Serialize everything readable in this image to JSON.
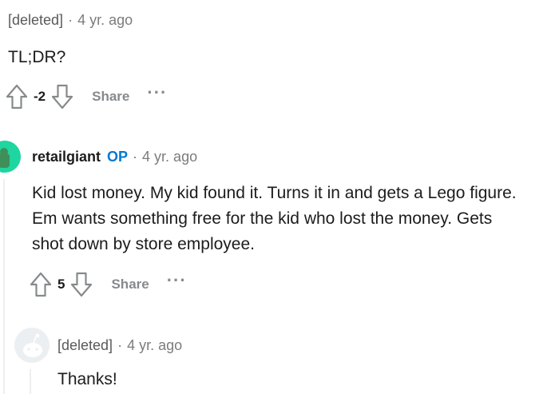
{
  "comment1": {
    "author": "[deleted]",
    "separator": "·",
    "time": "4 yr. ago",
    "body": "TL;DR?",
    "score": "-2",
    "share_label": "Share",
    "more_label": "···"
  },
  "comment2": {
    "author": "retailgiant",
    "op_badge": "OP",
    "separator": "·",
    "time": "4 yr. ago",
    "body": "Kid lost money. My kid found it. Turns it in and gets a Lego figure. Em wants something free for the kid who lost the money. Gets shot down by store employee.",
    "score": "5",
    "share_label": "Share",
    "more_label": "···",
    "avatar_icon": "snoo-avatar-icon",
    "avatar_color": "#1fd6a0"
  },
  "comment3": {
    "author": "[deleted]",
    "separator": "·",
    "time": "4 yr. ago",
    "body": "Thanks!",
    "avatar_icon": "deleted-user-avatar-icon"
  },
  "colors": {
    "text": "#1c1c1c",
    "meta": "#7c7c7c",
    "op": "#0079d3",
    "action": "#878a8c",
    "thread_line": "#edeff1"
  }
}
